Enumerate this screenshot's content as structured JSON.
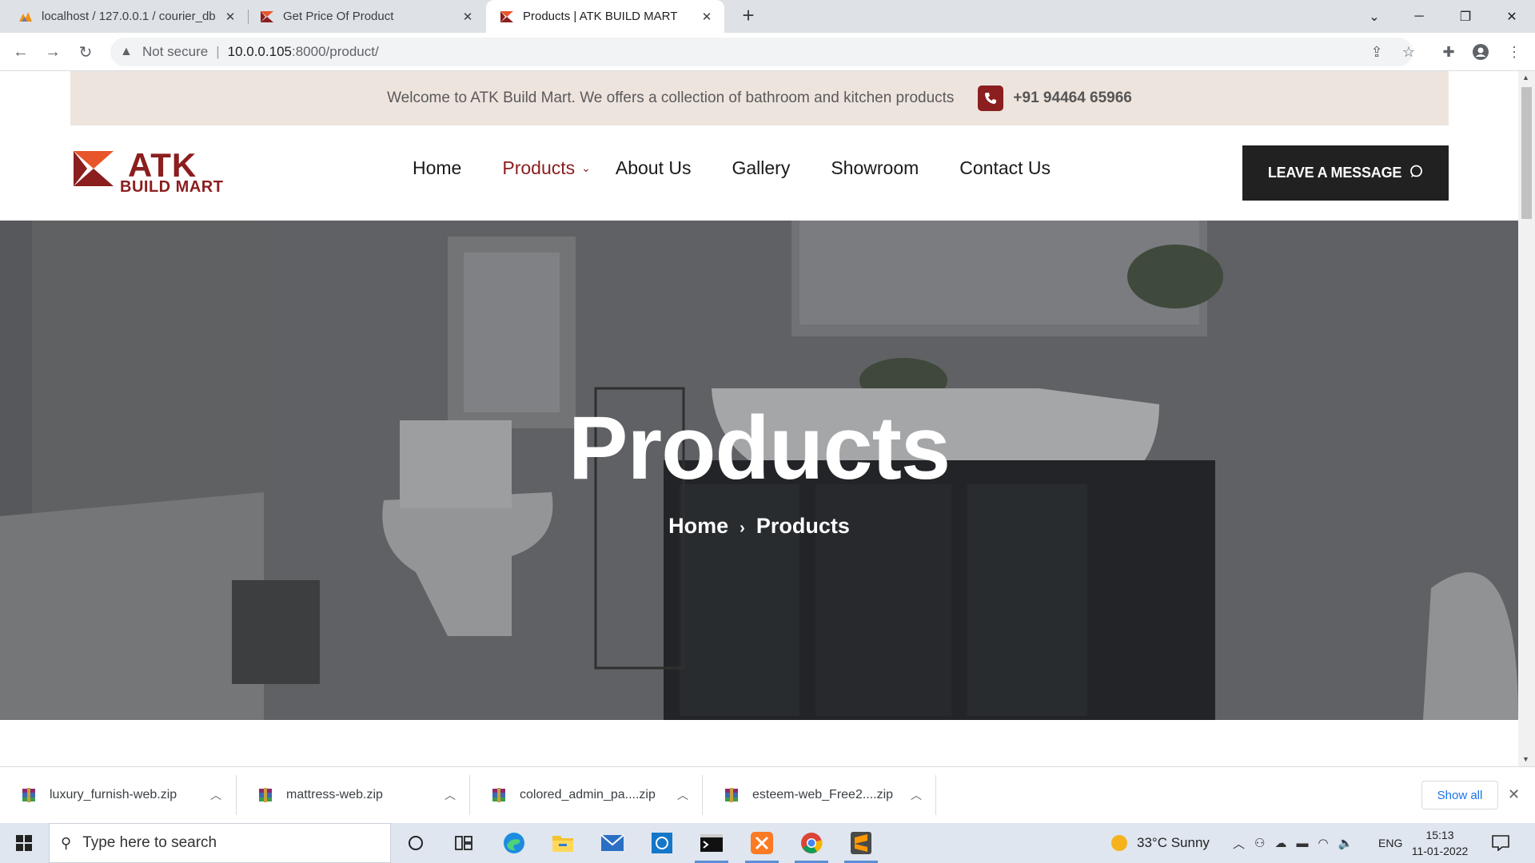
{
  "browser": {
    "tabs": [
      {
        "title": "localhost / 127.0.0.1 / courier_db",
        "icon": "phpmyadmin-icon"
      },
      {
        "title": "Get Price Of Product",
        "icon": "atk-favicon"
      },
      {
        "title": "Products | ATK BUILD MART",
        "icon": "atk-favicon",
        "active": true
      }
    ],
    "security_label": "Not secure",
    "url_host": "10.0.0.105",
    "url_path": ":8000/product/"
  },
  "site": {
    "welcome": "Welcome to ATK Build Mart. We offers a collection of bathroom and kitchen products",
    "phone": "+91 94464 65966",
    "logo_top": "ATK",
    "logo_bottom": "BUILD MART",
    "nav": [
      "Home",
      "Products",
      "About Us",
      "Gallery",
      "Showroom",
      "Contact Us"
    ],
    "active_nav": "Products",
    "cta": "LEAVE A MESSAGE",
    "hero_title": "Products",
    "breadcrumb": [
      "Home",
      "Products"
    ]
  },
  "downloads": {
    "items": [
      "luxury_furnish-web.zip",
      "mattress-web.zip",
      "colored_admin_pa....zip",
      "esteem-web_Free2....zip"
    ],
    "show_all": "Show all"
  },
  "taskbar": {
    "search_placeholder": "Type here to search",
    "weather": "33°C  Sunny",
    "lang": "ENG",
    "time": "15:13",
    "date": "11-01-2022"
  },
  "colors": {
    "brand": "#8b1e1e",
    "logo_orange": "#e8552a",
    "topbar_bg": "#eee4de",
    "cta_bg": "#212121"
  }
}
